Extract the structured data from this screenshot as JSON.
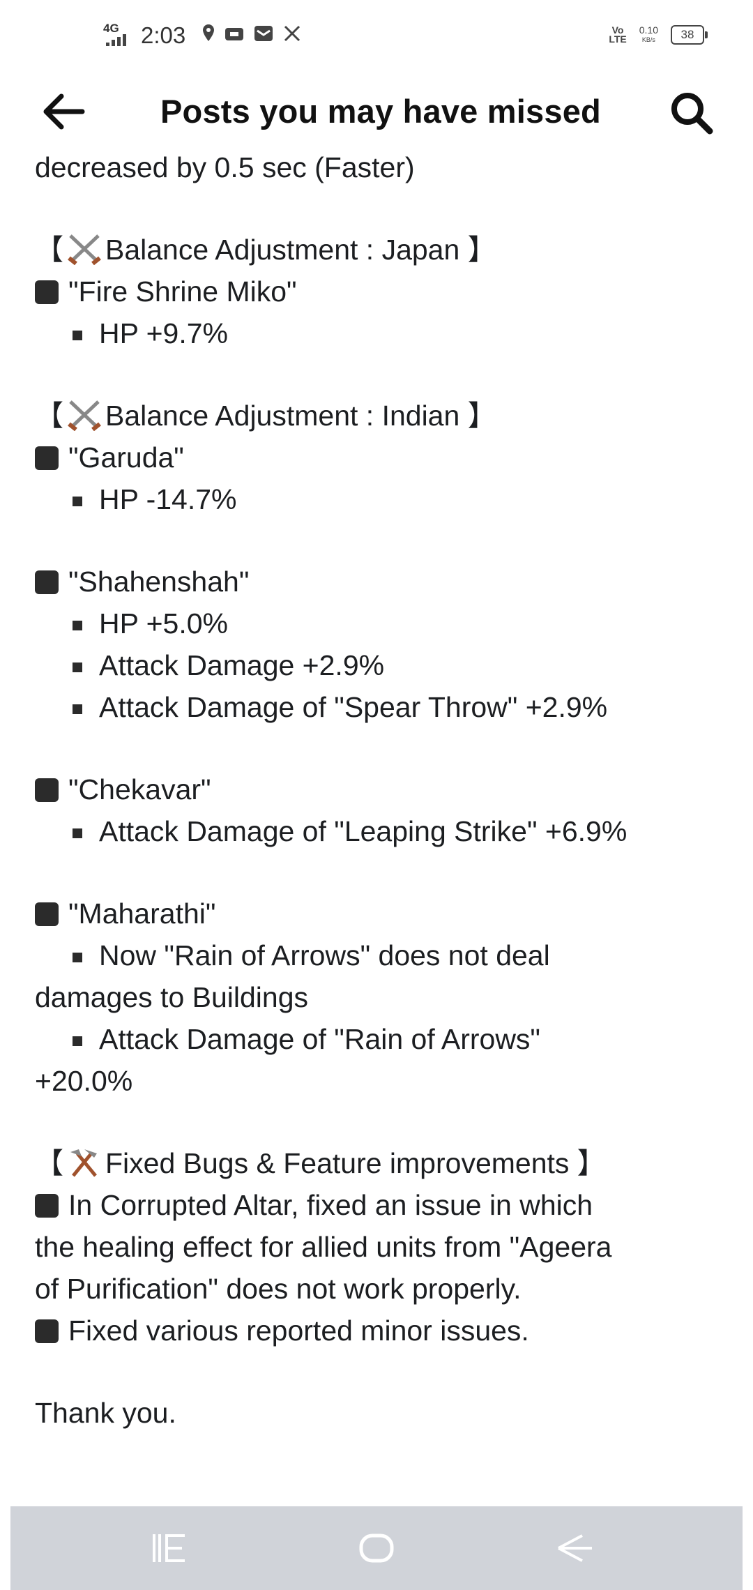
{
  "status_bar": {
    "network": "4G",
    "time": "2:03",
    "volte_top": "Vo",
    "volte_bottom": "LTE",
    "speed_value": "0.10",
    "speed_unit": "KB/s",
    "battery": "38"
  },
  "header": {
    "title": "Posts you may have missed"
  },
  "post": {
    "intro": "decreased by 0.5 sec (Faster)",
    "section_japan": {
      "open": "【",
      "title": "Balance Adjustment : Japan",
      "close": "】",
      "units": [
        {
          "name": "\"Fire Shrine Miko\"",
          "changes": [
            "HP +9.7%"
          ]
        }
      ]
    },
    "section_indian": {
      "open": "【",
      "title": "Balance Adjustment : Indian",
      "close": "】",
      "garuda": {
        "name": "\"Garuda\"",
        "changes": [
          "HP -14.7%"
        ]
      },
      "shahenshah": {
        "name": "\"Shahenshah\"",
        "changes": [
          "HP +5.0%",
          "Attack Damage +2.9%",
          "Attack Damage of \"Spear Throw\" +2.9%"
        ]
      },
      "chekavar": {
        "name": "\"Chekavar\"",
        "changes": [
          "Attack Damage of \"Leaping Strike\" +6.9%"
        ]
      },
      "maharathi": {
        "name": "\"Maharathi\"",
        "change1_a": "Now \"Rain of Arrows\" does not deal",
        "change1_b": "damages to Buildings",
        "change2_a": "Attack Damage of \"Rain of Arrows\"",
        "change2_b": "+20.0%"
      }
    },
    "section_bugs": {
      "open": "【",
      "title": "Fixed Bugs & Feature improvements",
      "close": "】",
      "item1_a": "In Corrupted Altar, fixed an issue in which",
      "item1_b": "the healing effect for allied units from \"Ageera",
      "item1_c": "of Purification\" does not work properly.",
      "item2": "Fixed various reported minor issues."
    },
    "closing": "Thank you."
  },
  "icons": {
    "back": "arrow-left-icon",
    "search": "search-icon",
    "swords": "crossed-swords-icon",
    "tools": "hammer-pick-icon",
    "nav_recents": "recent-apps-icon",
    "nav_home": "home-icon",
    "nav_back": "back-icon"
  }
}
